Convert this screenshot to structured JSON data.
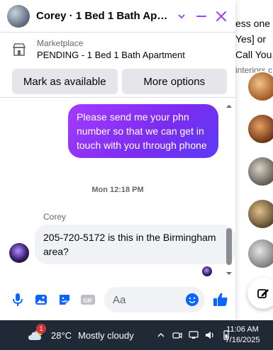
{
  "background": {
    "lines": [
      "ess one",
      "Yes] or",
      "Call You.",
      "interiors.c"
    ]
  },
  "header": {
    "title": "Corey · 1 Bed 1 Bath Apart...",
    "accent": "#a33bff"
  },
  "listing": {
    "label": "Marketplace",
    "status": "PENDING - 1 Bed 1 Bath Apartment"
  },
  "actions": {
    "mark_available": "Mark as available",
    "more_options": "More options"
  },
  "messages": {
    "outgoing": "Please send me your phn number so that we can get in touch with you through phone",
    "timestamp": "Mon 12:18 PM",
    "sender": "Corey",
    "incoming": "205-720-5172 is this in the Birmingham area?"
  },
  "composer": {
    "placeholder": "Aa"
  },
  "taskbar": {
    "weather_badge": "1",
    "temperature": "28°C",
    "condition": "Mostly cloudy",
    "time": "11:06 AM",
    "date": "7/16/2025"
  }
}
